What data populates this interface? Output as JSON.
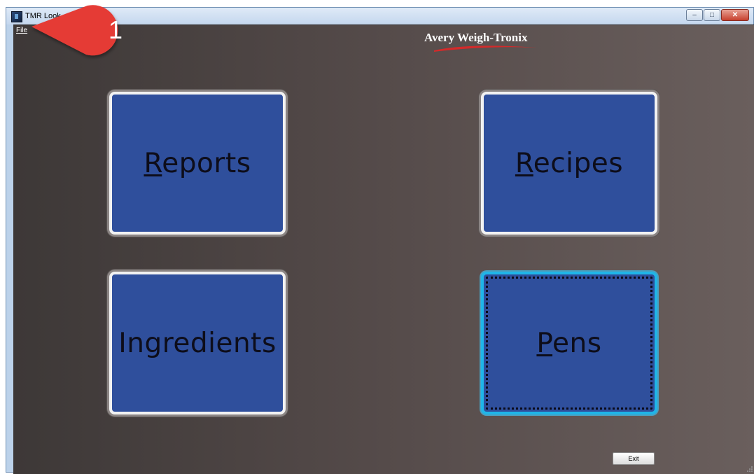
{
  "window": {
    "title": "TMR Look",
    "controls": {
      "minimize": "–",
      "maximize": "□",
      "close": "✕"
    }
  },
  "menu": {
    "file": "File"
  },
  "logo": {
    "text": "Avery Weigh-Tronix"
  },
  "tiles": [
    {
      "mnemonic": "R",
      "rest": "eports",
      "focused": false
    },
    {
      "mnemonic": "R",
      "rest": "ecipes",
      "focused": false
    },
    {
      "mnemonic": "",
      "rest": "Ingredients",
      "focused": false
    },
    {
      "mnemonic": "P",
      "rest": "ens",
      "focused": true
    }
  ],
  "exit_label": "Exit",
  "callout": {
    "number": "1"
  },
  "colors": {
    "tile_fill": "#2f4f9c",
    "focus_border": "#1fb5e8",
    "callout_red": "#e53b36"
  }
}
